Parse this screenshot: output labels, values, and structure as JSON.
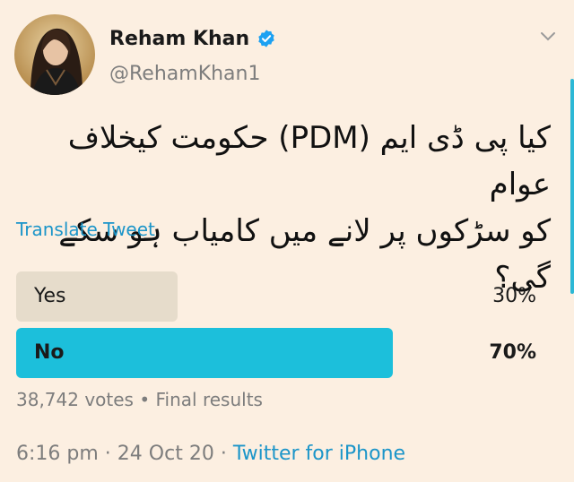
{
  "author": {
    "display_name": "Reham Khan",
    "handle": "@RehamKhan1",
    "verified": true
  },
  "tweet": {
    "text": "کیا پی ڈی ایم (PDM) حکومت کیخلاف عوام\nکو سڑکوں پر لانے میں کامیاب ہو سکے گی؟",
    "translate_label": "Translate Tweet"
  },
  "poll": {
    "options": [
      {
        "label": "Yes",
        "percent_label": "30%",
        "fraction": 0.3,
        "winner": false
      },
      {
        "label": "No",
        "percent_label": "70%",
        "fraction": 0.7,
        "winner": true
      }
    ],
    "votes": "38,742 votes",
    "separator": "•",
    "status": "Final results"
  },
  "footer": {
    "time": "6:16 pm",
    "dot": "·",
    "date": "24 Oct 20",
    "source": "Twitter for iPhone"
  },
  "colors": {
    "background": "#fcefe1",
    "poll_winner": "#1cbfdb",
    "poll_other": "#e6dccb",
    "link": "#1b95c9",
    "verified": "#1da1f2",
    "muted": "#7d7d7d"
  },
  "icons": {
    "avatar": "profile-photo",
    "verified": "verified-badge-icon",
    "menu": "chevron-down-icon"
  }
}
